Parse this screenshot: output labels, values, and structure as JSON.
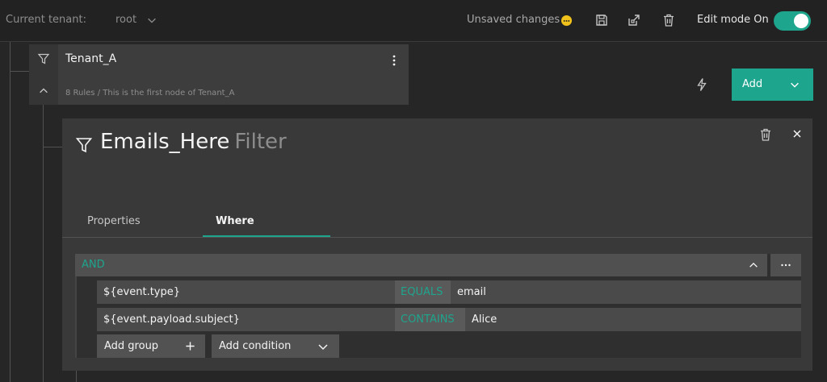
{
  "header": {
    "tenant_label": "Current tenant:",
    "tenant_value": "root",
    "unsaved_text": "Unsaved changes",
    "edit_mode_label": "Edit mode On",
    "edit_mode_on": true,
    "accent_color": "#1ea58d",
    "warning_color": "#f1c21b"
  },
  "node": {
    "title": "Tenant_A",
    "subtitle": "8 Rules / This is the first node of Tenant_A"
  },
  "actions": {
    "add_label": "Add"
  },
  "panel": {
    "title": "Emails_Here",
    "type": "Filter",
    "tabs": [
      {
        "label": "Properties",
        "active": false
      },
      {
        "label": "Where",
        "active": true
      }
    ],
    "group": {
      "operator": "AND",
      "conditions": [
        {
          "field": "${event.type}",
          "operator": "EQUALS",
          "value": "email"
        },
        {
          "field": "${event.payload.subject}",
          "operator": "CONTAINS",
          "value": "Alice"
        }
      ],
      "add_group_label": "Add group",
      "add_condition_label": "Add condition"
    }
  }
}
